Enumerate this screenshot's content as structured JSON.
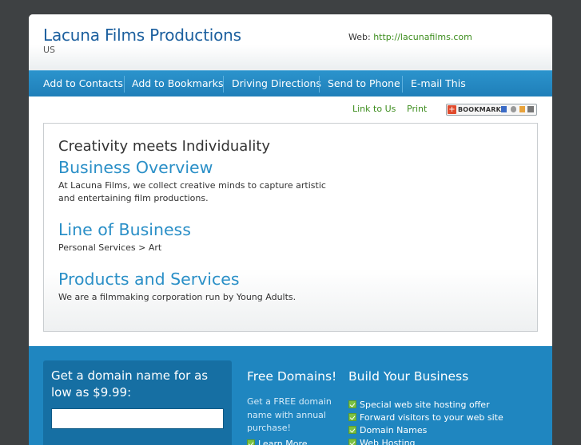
{
  "header": {
    "title": "Lacuna Films Productions",
    "country": "US",
    "web_label": "Web:",
    "web_url": "http://lacunafilms.com"
  },
  "nav": {
    "items": [
      "Add to Contacts",
      "Add to Bookmarks",
      "Driving Directions",
      "Send to Phone",
      "E-mail This"
    ]
  },
  "utility": {
    "link_to_us": "Link to Us",
    "print": "Print",
    "bookmark": "BOOKMARK"
  },
  "content": {
    "tagline": "Creativity meets Individuality",
    "sections": [
      {
        "heading": "Business Overview",
        "text": "At Lacuna Films, we collect creative minds to capture artistic and entertaining film productions."
      },
      {
        "heading": "Line of Business",
        "text": "Personal Services > Art"
      },
      {
        "heading": "Products and Services",
        "text": "We are a filmmaking corporation run by Young Adults."
      }
    ]
  },
  "footer": {
    "domain_heading": "Get a domain name for as low as $9.99:",
    "free_heading": "Free Domains!",
    "free_text": "Get a FREE domain name with annual purchase!",
    "learn_more": "Learn More",
    "build_heading": "Build Your Business",
    "build_items": [
      "Special web site hosting offer",
      "Forward visitors to your web site",
      "Domain Names",
      "Web Hosting"
    ]
  },
  "colors": {
    "brand_blue": "#1b5f9e",
    "nav_blue": "#2b93cc",
    "link_green": "#3e8e1f",
    "heading_blue": "#2a8fc7",
    "footer_blue": "#1f86c0"
  }
}
